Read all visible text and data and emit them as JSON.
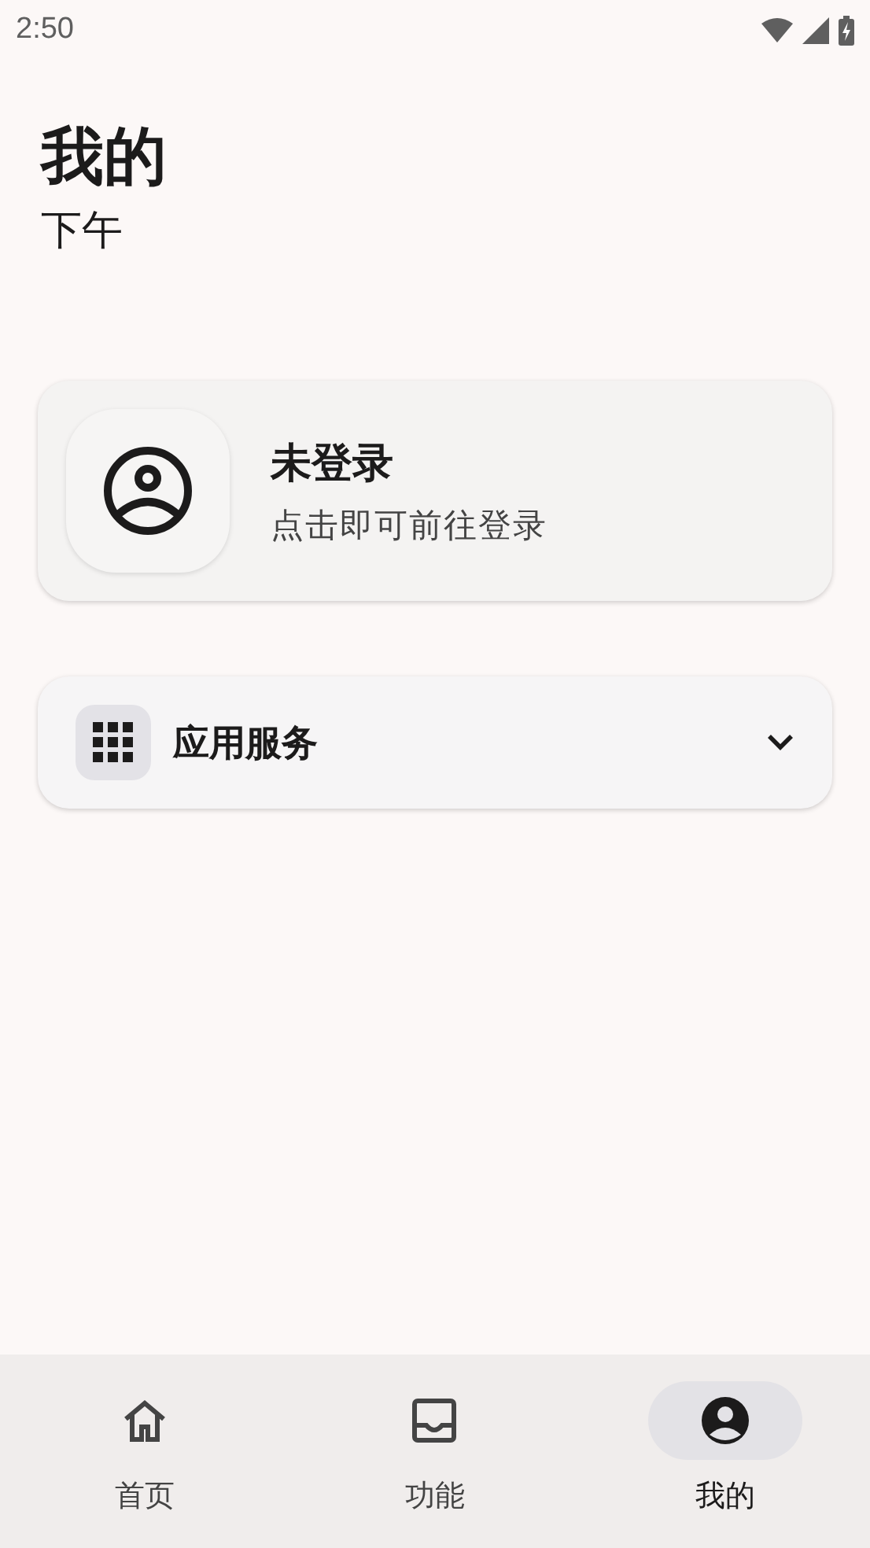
{
  "status_bar": {
    "time": "2:50"
  },
  "header": {
    "title": "我的",
    "subtitle": "下午"
  },
  "account_card": {
    "name": "未登录",
    "hint": "点击即可前往登录"
  },
  "services": {
    "label": "应用服务",
    "expanded": false
  },
  "bottom_nav": [
    {
      "label": "首页",
      "kind": "home",
      "selected": false
    },
    {
      "label": "功能",
      "kind": "inbox",
      "selected": false
    },
    {
      "label": "我的",
      "kind": "account",
      "selected": true
    }
  ]
}
